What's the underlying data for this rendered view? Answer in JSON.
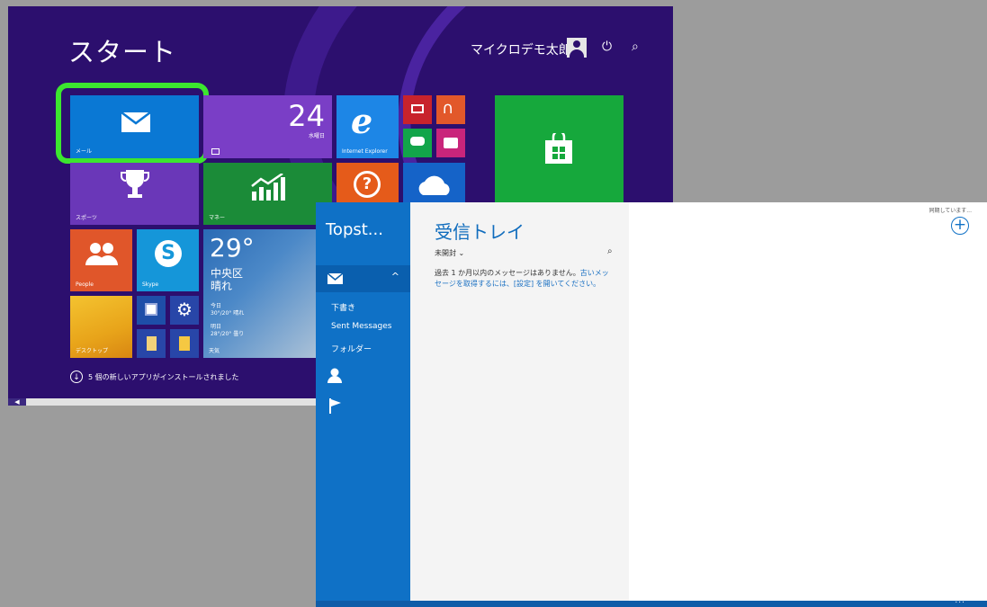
{
  "start_screen": {
    "title": "スタート",
    "user_name": "マイクロデモ太郎",
    "power_icon": "⏻",
    "search_icon": "⌕",
    "tiles": {
      "mail": {
        "label": "メール"
      },
      "calendar": {
        "day": "24",
        "weekday": "水曜日"
      },
      "ie": {
        "label": "Internet Explorer"
      },
      "sports": {
        "label": "スポーツ"
      },
      "money": {
        "label": "マネー"
      },
      "people": {
        "label": "People"
      },
      "skype": {
        "label": "Skype"
      },
      "weather": {
        "temp": "29°",
        "city": "中央区",
        "condition": "晴れ",
        "today_label": "今日",
        "today_value": "30°/20° 晴れ",
        "tomorrow_label": "明日",
        "tomorrow_value": "28°/20° 曇り",
        "label": "天気"
      },
      "desktop": {
        "label": "デスクトップ"
      }
    },
    "bottom_note": "5 個の新しいアプリがインストールされました"
  },
  "mail_app": {
    "account_name": "Topst...",
    "folders": [
      "下書き",
      "Sent Messages",
      "フォルダー"
    ],
    "inbox_title": "受信トレイ",
    "filter_label": "未開封",
    "empty_message_prefix": "過去 1 か月以内のメッセージはありません。",
    "empty_message_link": "古いメッセージを取得するには、[設定] を開いてください。",
    "sync_status": "同期しています...",
    "new_button": "+",
    "more_dots": "..."
  },
  "colors": {
    "start_bg": "#2c0f6e",
    "mail_highlight": "#3ce62f",
    "mail_blue": "#0f71c6"
  }
}
